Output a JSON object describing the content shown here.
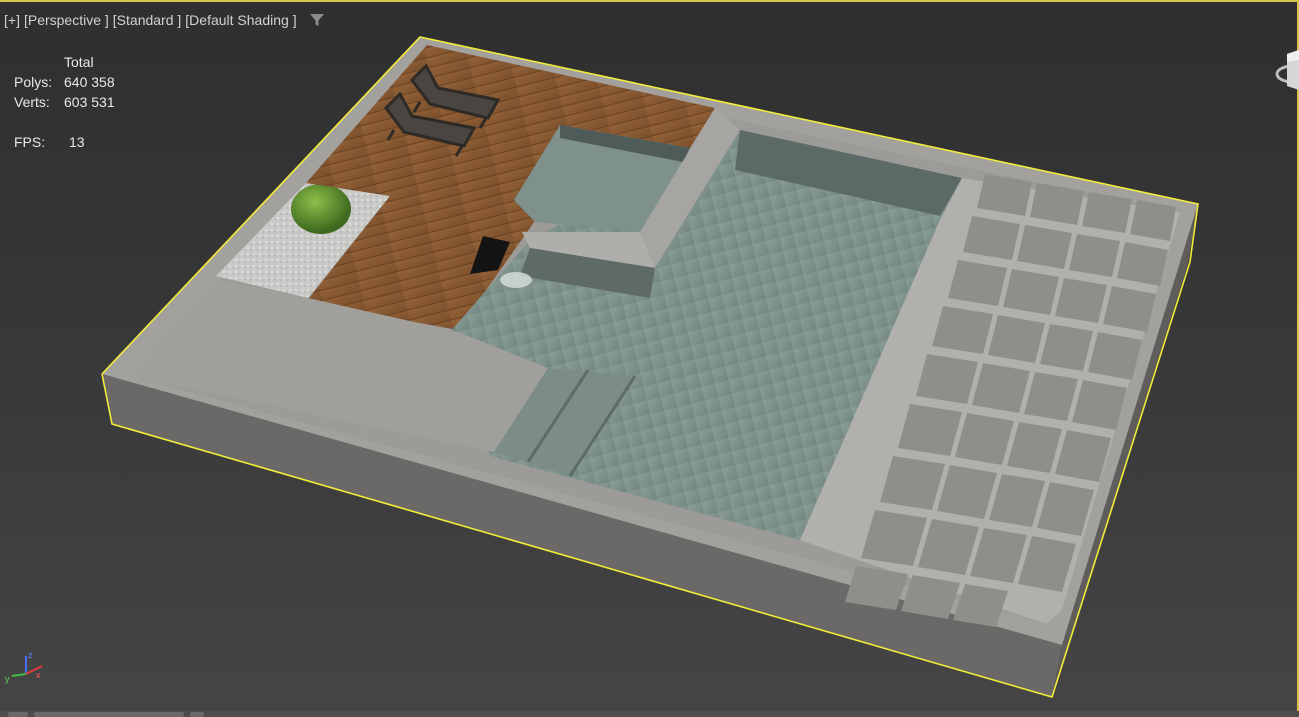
{
  "viewport": {
    "labels": {
      "plus": "[+]",
      "view": "[Perspective ]",
      "mode": "[Standard ]",
      "shading": "[Default Shading ]"
    },
    "filter_icon": "funnel-icon"
  },
  "stats": {
    "total_header": "Total",
    "polys_label": "Polys:",
    "polys_value": "640 358",
    "verts_label": "Verts:",
    "verts_value": "603 531",
    "fps_label": "FPS:",
    "fps_value": "13"
  },
  "gizmo": {
    "z_label": "z",
    "x_label": "x",
    "y_label": "y"
  },
  "colors": {
    "selection": "#f2ec3a",
    "concrete": "#9a9896",
    "wood": "#8a5a32",
    "water": "#7b8f88",
    "tile": "#6f6e6c"
  }
}
